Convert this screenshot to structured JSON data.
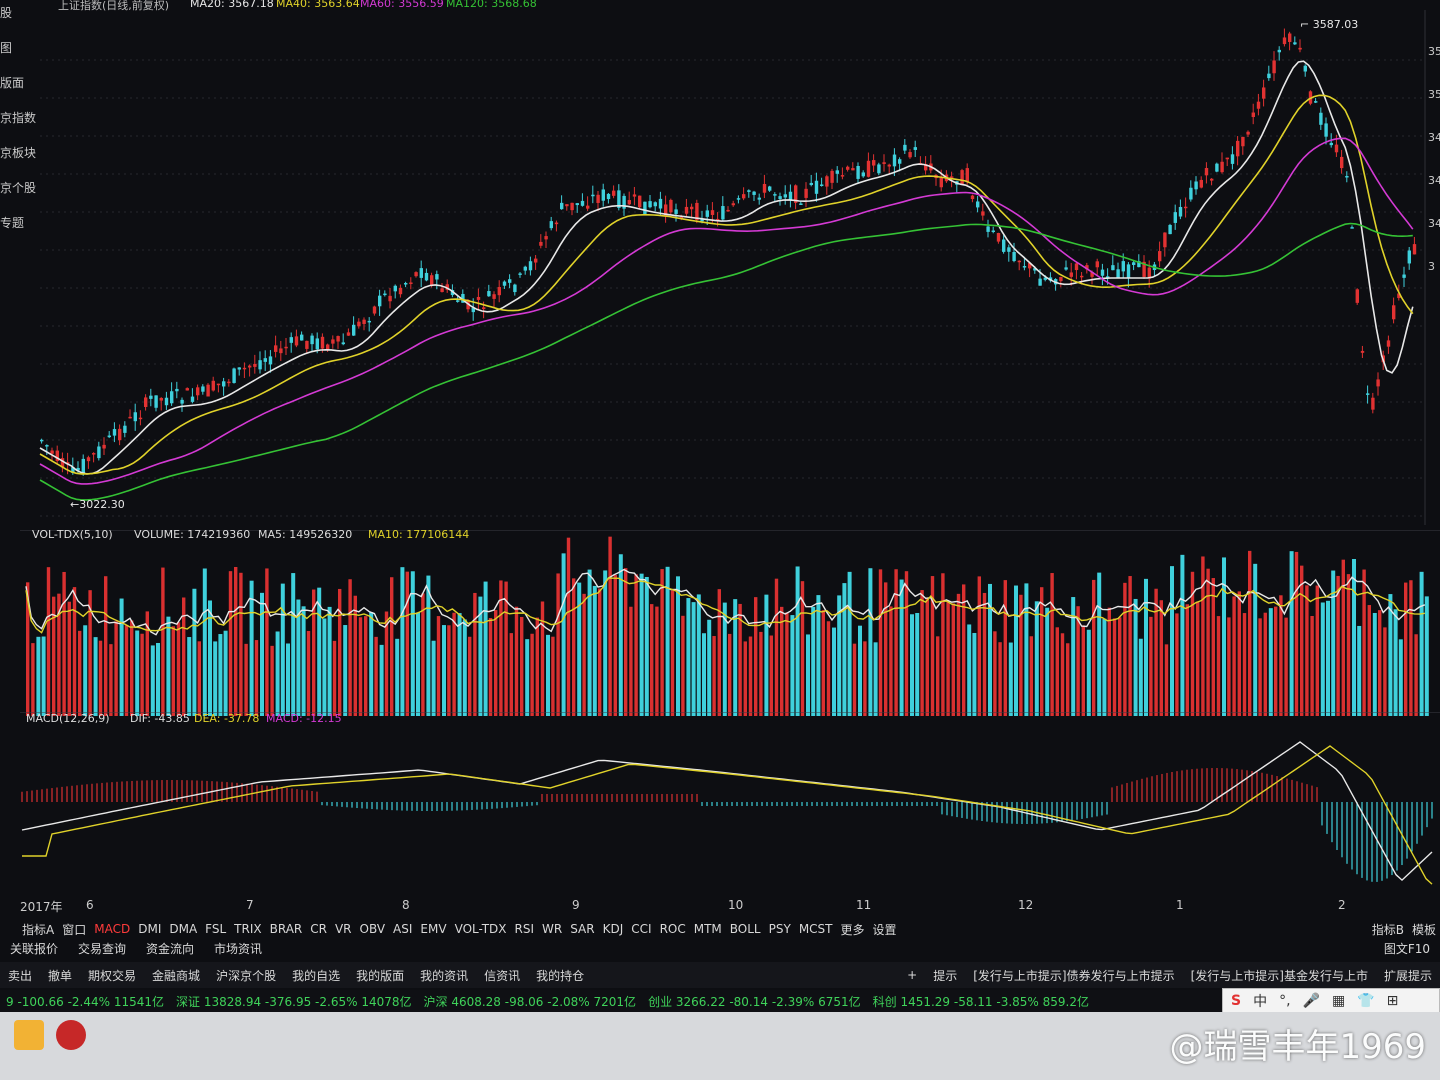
{
  "sidebar": {
    "items": [
      "股",
      "图",
      "版面",
      "京指数",
      "京板块",
      "京个股",
      "专题"
    ]
  },
  "main_chart": {
    "title": "上证指数(日线,前复权)",
    "ma_labels": [
      {
        "text": "MA20: 3567.18",
        "color": "#e8e8e8"
      },
      {
        "text": "MA40: 3563.64",
        "color": "#e0d22a"
      },
      {
        "text": "MA60: 3556.59",
        "color": "#d43ad4"
      },
      {
        "text": "MA120: 3568.68",
        "color": "#35c235"
      }
    ],
    "high_label": "3587.03",
    "low_label": "3022.30",
    "right_axis": [
      "35",
      "35",
      "34",
      "34",
      "34",
      "3"
    ],
    "colors": {
      "up": "#e23232",
      "down": "#3fd0dc",
      "ma20": "#e8e8e8",
      "ma40": "#e0d22a",
      "ma60": "#d43ad4",
      "ma120": "#35c235"
    }
  },
  "volume_panel": {
    "name": "VOL-TDX(5,10)",
    "volume_label": "VOLUME: 174219360",
    "ma5_label": "MA5: 149526320",
    "ma10_label": "MA10: 177106144"
  },
  "macd_panel": {
    "name": "MACD(12,26,9)",
    "dif_label": "DIF: -43.85",
    "dea_label": "DEA: -37.78",
    "macd_label": "MACD: -12.15"
  },
  "x_axis": {
    "year": "2017年",
    "months": [
      "6",
      "7",
      "8",
      "9",
      "10",
      "11",
      "12",
      "1",
      "2"
    ]
  },
  "tabs": [
    "指标A",
    "窗口",
    "MACD",
    "DMI",
    "DMA",
    "FSL",
    "TRIX",
    "BRAR",
    "CR",
    "VR",
    "OBV",
    "ASI",
    "EMV",
    "VOL-TDX",
    "RSI",
    "WR",
    "SAR",
    "KDJ",
    "CCI",
    "ROC",
    "MTM",
    "BOLL",
    "PSY",
    "MCST",
    "更多",
    "设置"
  ],
  "tabs_right": [
    "指标B",
    "模板"
  ],
  "functions": [
    "关联报价",
    "交易查询",
    "资金流向",
    "市场资讯"
  ],
  "f10": "图文F10",
  "toolbar": [
    "卖出",
    "撤单",
    "期权交易",
    "金融商城",
    "沪深京个股",
    "我的自选",
    "我的版面",
    "我的资讯",
    "信资讯",
    "我的持仓"
  ],
  "toolbar_right": [
    "+",
    "提示",
    "[发行与上市提示]债券发行与上市提示",
    "[发行与上市提示]基金发行与上市",
    "扩展提示"
  ],
  "ticker": [
    {
      "text": "9  -100.66  -2.44%  11541亿"
    },
    {
      "text": "深证 13828.94  -376.95  -2.65%  14078亿"
    },
    {
      "text": "沪深 4608.28  -98.06  -2.08%  7201亿"
    },
    {
      "text": "创业 3266.22  -80.14  -2.39%  6751亿"
    },
    {
      "text": "科创 1451.29  -58.11  -3.85%  859.2亿"
    }
  ],
  "ime": [
    "S",
    "中",
    "°,",
    "🎤",
    "▦",
    "👕",
    "⊞"
  ],
  "watermark": "@瑞雪丰年1969"
}
